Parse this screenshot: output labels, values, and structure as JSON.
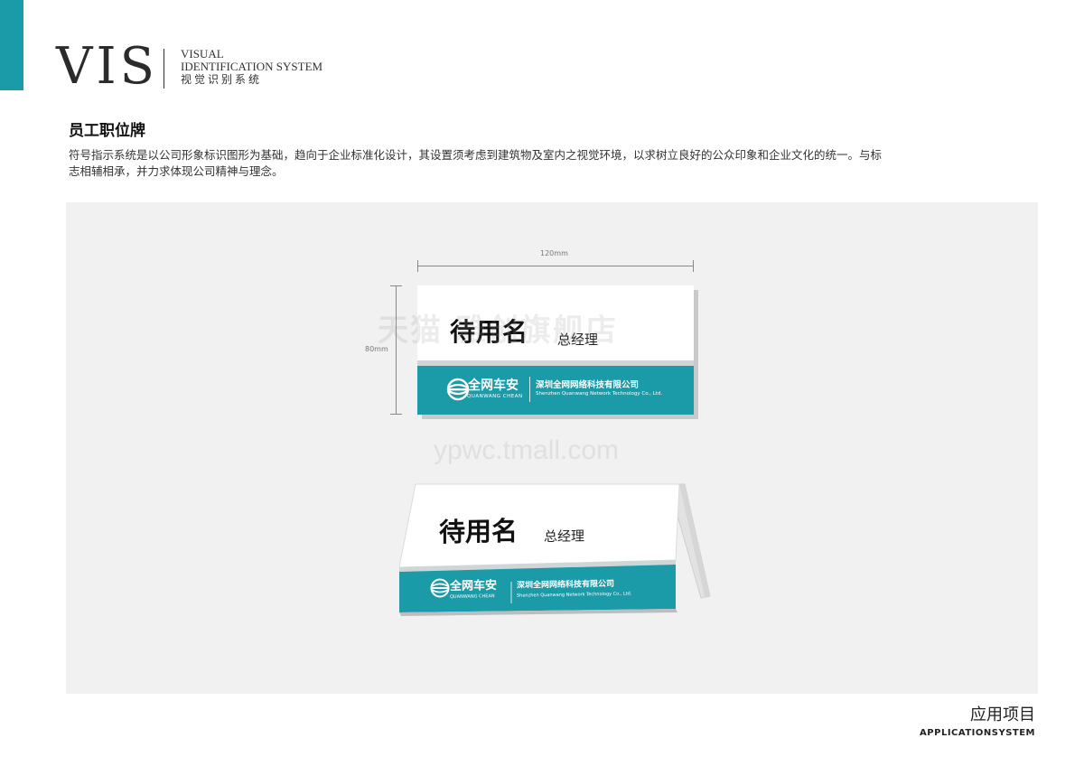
{
  "header": {
    "logo": "VIS",
    "sub_en_1": "VISUAL",
    "sub_en_2": "IDENTIFICATION SYSTEM",
    "sub_cn": "视觉识别系统",
    "accent_color": "#1b9aa8"
  },
  "section": {
    "title": "员工职位牌",
    "description": "符号指示系统是以公司形象标识图形为基础，趋向于企业标准化设计，其设置须考虑到建筑物及室内之视觉环境，以求树立良好的公众印象和企业文化的统一。与标志相辅相承，并力求体现公司精神与理念。"
  },
  "dimensions": {
    "width_label": "120mm",
    "height_label": "80mm"
  },
  "card": {
    "name": "待用名",
    "position": "总经理",
    "brand_cn": "全网车安",
    "brand_en": "QUANWANG CHEAN",
    "company_cn": "深圳全网网络科技有限公司",
    "company_en": "Shenzhen Quanwang Network Technology Co., Ltd.",
    "band_color": "#1b9aa8"
  },
  "watermark": {
    "line1": "天猫 雅创旗舰店",
    "line2": "ypwc.tmall.com"
  },
  "footer": {
    "cn": "应用项目",
    "en": "APPLICATIONSYSTEM"
  }
}
